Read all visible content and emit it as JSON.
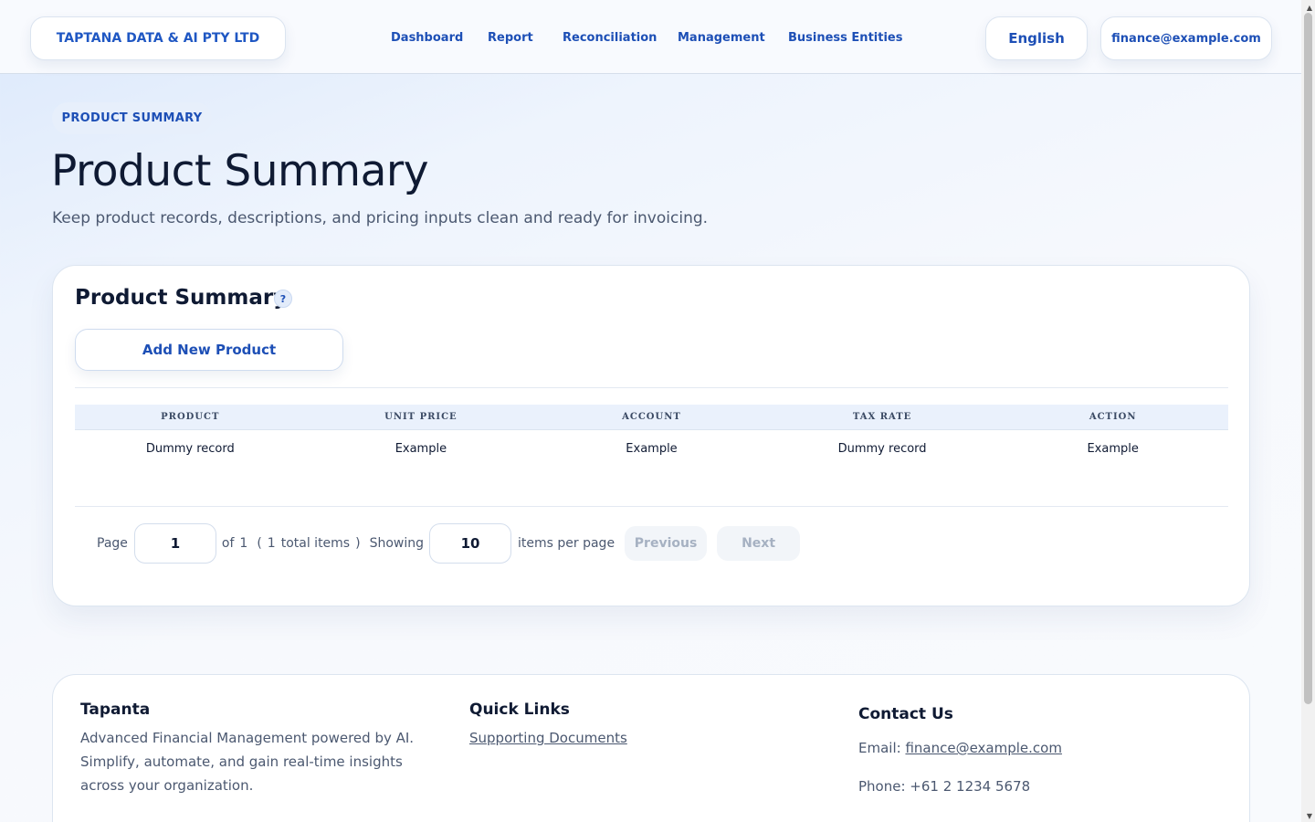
{
  "header": {
    "brand": "TAPTANA DATA & AI PTY LTD",
    "nav": [
      "Dashboard",
      "Report",
      "Reconciliation",
      "Management",
      "Business Entities"
    ],
    "language": "English",
    "account": "finance@example.com"
  },
  "hero": {
    "breadcrumb": "PRODUCT SUMMARY",
    "title": "Product Summary",
    "subtitle": "Keep product records, descriptions, and pricing inputs clean and ready for invoicing."
  },
  "card": {
    "title": "Product Summary",
    "help_icon": "?",
    "add_button": "Add New Product",
    "columns": [
      "PRODUCT",
      "UNIT PRICE",
      "ACCOUNT",
      "TAX RATE",
      "ACTION"
    ],
    "rows": [
      [
        "Dummy record",
        "Example",
        "Example",
        "Dummy record",
        "Example"
      ]
    ],
    "pager": {
      "page_label": "Page",
      "page_value": "1",
      "of_label": "of",
      "total_pages": "1",
      "open_paren": "(",
      "total_items": "1",
      "total_items_label": "total items",
      "close_paren": ")",
      "showing_label": "Showing",
      "per_page_value": "10",
      "per_page_label": "items per page",
      "previous": "Previous",
      "next": "Next"
    }
  },
  "footer": {
    "brand_heading": "Tapanta",
    "brand_text": "Advanced Financial Management powered by AI. Simplify, automate, and gain real-time insights across your organization.",
    "links_heading": "Quick Links",
    "links": [
      "Supporting Documents"
    ],
    "contact_heading": "Contact Us",
    "email_label": "Email:",
    "email": "finance@example.com",
    "phone": "Phone: +61 2 1234 5678"
  }
}
